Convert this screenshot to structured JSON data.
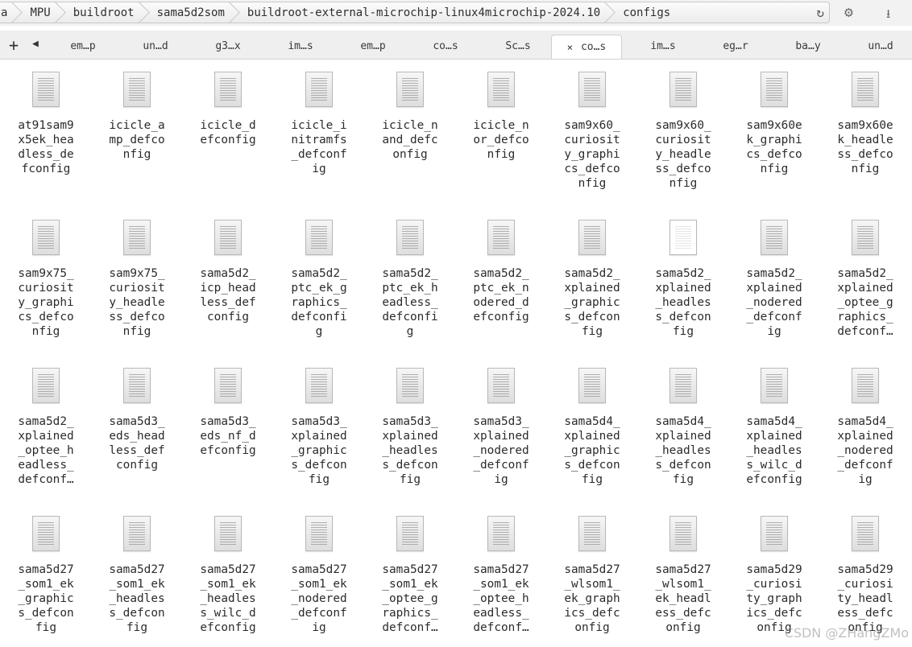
{
  "breadcrumbs": [
    "a",
    "MPU",
    "buildroot",
    "sama5d2som",
    "buildroot-external-microchip-linux4microchip-2024.10",
    "configs"
  ],
  "icons": {
    "reload": "reload-icon",
    "settings": "gear-icon",
    "download": "download-icon",
    "new_tab": "plus-icon",
    "scroll_left": "triangle-left-icon",
    "file": "text-file-icon"
  },
  "tabs": [
    {
      "label": "em…p",
      "active": false
    },
    {
      "label": "un…d",
      "active": false
    },
    {
      "label": "g3…x",
      "active": false
    },
    {
      "label": "im…s",
      "active": false
    },
    {
      "label": "em…p",
      "active": false
    },
    {
      "label": "co…s",
      "active": false
    },
    {
      "label": "Sc…s",
      "active": false
    },
    {
      "label": "co…s",
      "active": true,
      "close_glyph": "×"
    },
    {
      "label": "im…s",
      "active": false
    },
    {
      "label": "eg…r",
      "active": false
    },
    {
      "label": "ba…y",
      "active": false
    },
    {
      "label": "un…d",
      "active": false
    }
  ],
  "files": [
    {
      "name": "at91sam9\nx5ek_hea\ndless_de\nfconfig"
    },
    {
      "name": "icicle_a\nmp_defco\nnfig"
    },
    {
      "name": "icicle_d\nefconfig"
    },
    {
      "name": "icicle_i\nnitramfs\n_defconf\nig"
    },
    {
      "name": "icicle_n\nand_defc\nonfig"
    },
    {
      "name": "icicle_n\nor_defco\nnfig"
    },
    {
      "name": "sam9x60_\ncuriosit\ny_graphi\ncs_defco\nnfig"
    },
    {
      "name": "sam9x60_\ncuriosit\ny_headle\nss_defco\nnfig"
    },
    {
      "name": "sam9x60e\nk_graphi\ncs_defco\nnfig"
    },
    {
      "name": "sam9x60e\nk_headle\nss_defco\nnfig"
    },
    {
      "name": "sam9x75_\ncuriosit\ny_graphi\ncs_defco\nnfig"
    },
    {
      "name": "sam9x75_\ncuriosit\ny_headle\nss_defco\nnfig"
    },
    {
      "name": "sama5d2_\nicp_head\nless_def\nconfig"
    },
    {
      "name": "sama5d2_\nptc_ek_g\nraphics_\ndefconfi\ng"
    },
    {
      "name": "sama5d2_\nptc_ek_h\neadless_\ndefconfi\ng"
    },
    {
      "name": "sama5d2_\nptc_ek_n\nodered_d\nefconfig"
    },
    {
      "name": "sama5d2_\nxplained\n_graphic\ns_defcon\nfig"
    },
    {
      "name": "sama5d2_\nxplained\n_headles\ns_defcon\nfig",
      "light": true
    },
    {
      "name": "sama5d2_\nxplained\n_nodered\n_defconf\nig"
    },
    {
      "name": "sama5d2_\nxplained\n_optee_g\nraphics_\ndefconf…"
    },
    {
      "name": "sama5d2_\nxplained\n_optee_h\neadless_\ndefconf…"
    },
    {
      "name": "sama5d3_\neds_head\nless_def\nconfig"
    },
    {
      "name": "sama5d3_\neds_nf_d\nefconfig"
    },
    {
      "name": "sama5d3_\nxplained\n_graphic\ns_defcon\nfig"
    },
    {
      "name": "sama5d3_\nxplained\n_headles\ns_defcon\nfig"
    },
    {
      "name": "sama5d3_\nxplained\n_nodered\n_defconf\nig"
    },
    {
      "name": "sama5d4_\nxplained\n_graphic\ns_defcon\nfig"
    },
    {
      "name": "sama5d4_\nxplained\n_headles\ns_defcon\nfig"
    },
    {
      "name": "sama5d4_\nxplained\n_headles\ns_wilc_d\nefconfig"
    },
    {
      "name": "sama5d4_\nxplained\n_nodered\n_defconf\nig"
    },
    {
      "name": "sama5d27\n_som1_ek\n_graphic\ns_defcon\nfig"
    },
    {
      "name": "sama5d27\n_som1_ek\n_headles\ns_defcon\nfig"
    },
    {
      "name": "sama5d27\n_som1_ek\n_headles\ns_wilc_d\nefconfig"
    },
    {
      "name": "sama5d27\n_som1_ek\n_nodered\n_defconf\nig"
    },
    {
      "name": "sama5d27\n_som1_ek\n_optee_g\nraphics_\ndefconf…"
    },
    {
      "name": "sama5d27\n_som1_ek\n_optee_h\neadless_\ndefconf…"
    },
    {
      "name": "sama5d27\n_wlsom1_\nek_graph\nics_defc\nonfig"
    },
    {
      "name": "sama5d27\n_wlsom1_\nek_headl\ness_defc\nonfig"
    },
    {
      "name": "sama5d29\n_curiosi\nty_graph\nics_defc\nonfig"
    },
    {
      "name": "sama5d29\n_curiosi\nty_headl\ness_defc\nonfig"
    }
  ],
  "watermark": "CSDN @ZHangZMo"
}
